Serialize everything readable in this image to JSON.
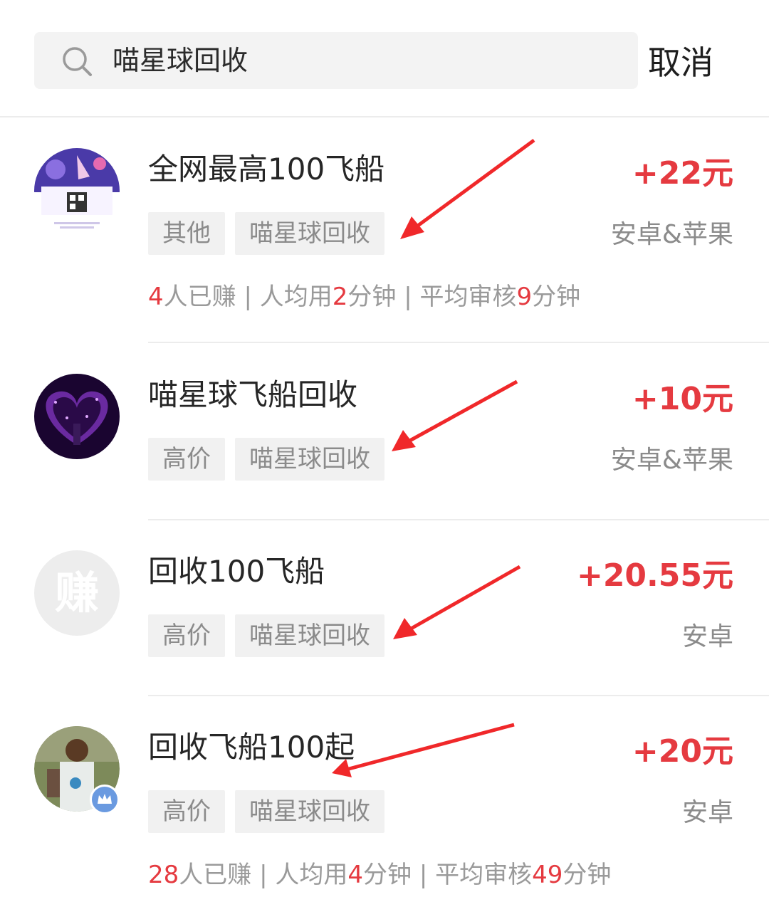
{
  "search": {
    "query": "喵星球回收",
    "cancel_label": "取消"
  },
  "tasks": [
    {
      "title": "全网最高100飞船",
      "reward": "+22元",
      "tags": [
        "其他",
        "喵星球回收"
      ],
      "platform": "安卓&苹果",
      "stats": {
        "earned_count": "4",
        "earned_suffix": "人已赚",
        "avg_time_prefix": "人均用",
        "avg_time": "2",
        "avg_time_unit": "分钟",
        "review_prefix": "平均审核",
        "review_time": "9",
        "review_unit": "分钟"
      }
    },
    {
      "title": "喵星球飞船回收",
      "reward": "+10元",
      "tags": [
        "高价",
        "喵星球回收"
      ],
      "platform": "安卓&苹果"
    },
    {
      "title": "回收100飞船",
      "reward": "+20.55元",
      "tags": [
        "高价",
        "喵星球回收"
      ],
      "platform": "安卓",
      "avatar_text": "赚"
    },
    {
      "title": "回收飞船100起",
      "reward": "+20元",
      "tags": [
        "高价",
        "喵星球回收"
      ],
      "platform": "安卓",
      "stats": {
        "earned_count": "28",
        "earned_suffix": "人已赚",
        "avg_time_prefix": "人均用",
        "avg_time": "4",
        "avg_time_unit": "分钟",
        "review_prefix": "平均审核",
        "review_time": "49",
        "review_unit": "分钟"
      }
    }
  ],
  "separator": "|",
  "colors": {
    "accent": "#e53a40",
    "tag_bg": "#f1f1f1",
    "muted_text": "#8b8b8b"
  }
}
